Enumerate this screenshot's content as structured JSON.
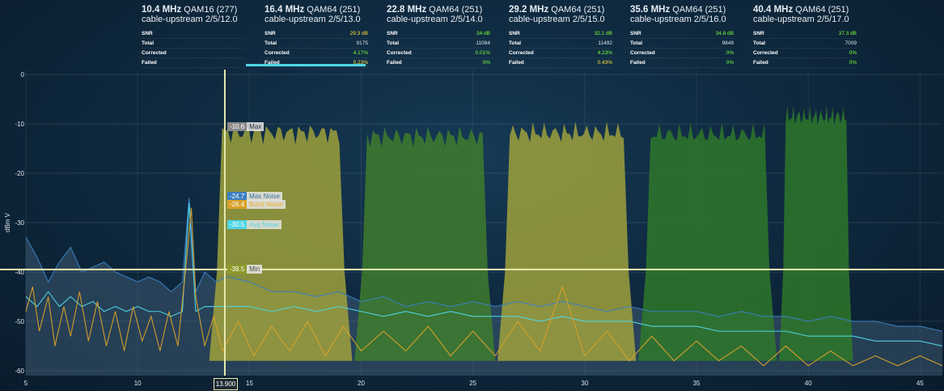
{
  "channels": [
    {
      "freq": "10.4 MHz",
      "mod": "QAM16 (277)",
      "name": "cable-upstream 2/5/12.0",
      "rows": [
        {
          "label": "SNR",
          "value": "",
          "cls": ""
        },
        {
          "label": "Total",
          "value": "",
          "cls": ""
        },
        {
          "label": "Corrected",
          "value": "",
          "cls": ""
        },
        {
          "label": "Failed",
          "value": "",
          "cls": ""
        }
      ],
      "selected": false
    },
    {
      "freq": "16.4 MHz",
      "mod": "QAM64 (251)",
      "name": "cable-upstream 2/5/13.0",
      "rows": [
        {
          "label": "SNR",
          "value": "29.3 dB",
          "cls": "warn"
        },
        {
          "label": "Total",
          "value": "9175",
          "cls": ""
        },
        {
          "label": "Corrected",
          "value": "4.17%",
          "cls": "ok"
        },
        {
          "label": "Failed",
          "value": "0.23%",
          "cls": "warn"
        }
      ],
      "selected": true
    },
    {
      "freq": "22.8 MHz",
      "mod": "QAM64 (251)",
      "name": "cable-upstream 2/5/14.0",
      "rows": [
        {
          "label": "SNR",
          "value": "34 dB",
          "cls": "ok"
        },
        {
          "label": "Total",
          "value": "11084",
          "cls": ""
        },
        {
          "label": "Corrected",
          "value": "0.01%",
          "cls": "ok"
        },
        {
          "label": "Failed",
          "value": "0%",
          "cls": "ok"
        }
      ],
      "selected": false
    },
    {
      "freq": "29.2 MHz",
      "mod": "QAM64 (251)",
      "name": "cable-upstream 2/5/15.0",
      "rows": [
        {
          "label": "SNR",
          "value": "32.1 dB",
          "cls": "ok"
        },
        {
          "label": "Total",
          "value": "11492",
          "cls": ""
        },
        {
          "label": "Corrected",
          "value": "4.23%",
          "cls": "ok"
        },
        {
          "label": "Failed",
          "value": "0.43%",
          "cls": "warn"
        }
      ],
      "selected": false
    },
    {
      "freq": "35.6 MHz",
      "mod": "QAM64 (251)",
      "name": "cable-upstream 2/5/16.0",
      "rows": [
        {
          "label": "SNR",
          "value": "34.8 dB",
          "cls": "ok"
        },
        {
          "label": "Total",
          "value": "9849",
          "cls": ""
        },
        {
          "label": "Corrected",
          "value": "0%",
          "cls": "ok"
        },
        {
          "label": "Failed",
          "value": "0%",
          "cls": "ok"
        }
      ],
      "selected": false
    },
    {
      "freq": "40.4 MHz",
      "mod": "QAM64 (251)",
      "name": "cable-upstream 2/5/17.0",
      "rows": [
        {
          "label": "SNR",
          "value": "37.3 dB",
          "cls": "ok"
        },
        {
          "label": "Total",
          "value": "7009",
          "cls": ""
        },
        {
          "label": "Corrected",
          "value": "0%",
          "cls": "ok"
        },
        {
          "label": "Failed",
          "value": "0%",
          "cls": "ok"
        }
      ],
      "selected": false
    }
  ],
  "chart_data": {
    "type": "area",
    "xlim": [
      5,
      46
    ],
    "ylim": [
      -61,
      1
    ],
    "x_ticks": [
      5,
      10,
      15,
      20,
      25,
      30,
      35,
      40,
      45
    ],
    "y_ticks": [
      0,
      -10,
      -20,
      -30,
      -40,
      -50,
      -60
    ],
    "ylabel": "dBm V",
    "cursor_x": 13.9,
    "cursor_label": "13.900",
    "cursor_markers": [
      {
        "value": "-10.6",
        "name": "Max",
        "y": -10.6,
        "color": "#8a8a8a",
        "text_color": "#ffffff"
      },
      {
        "value": "-24.7",
        "name": "Max Noise",
        "y": -24.7,
        "color": "#3a7fc0",
        "text_color": "#b9d4ee"
      },
      {
        "value": "-26.4",
        "name": "Burst Noise",
        "y": -26.4,
        "color": "#d9a12a",
        "text_color": "#f0b030"
      },
      {
        "value": "-30.5",
        "name": "Avg Noise",
        "y": -30.5,
        "color": "#4fd7e6",
        "text_color": "#4fd7e6"
      },
      {
        "value": "-39.5",
        "name": "Min",
        "y": -39.5,
        "color": "#8d9a2a",
        "text_color": "#e8e8b0"
      }
    ],
    "min_line_y": -39.5,
    "channel_blocks": [
      {
        "x0": 13.2,
        "x1": 19.6,
        "top": -10.3,
        "color": "#a3a53a"
      },
      {
        "x0": 19.7,
        "x1": 26.0,
        "top": -11.0,
        "color": "#3f7f2c"
      },
      {
        "x0": 26.1,
        "x1": 32.3,
        "top": -10.3,
        "color": "#a3a53a"
      },
      {
        "x0": 32.4,
        "x1": 38.6,
        "top": -10.6,
        "color": "#2f7a2a"
      },
      {
        "x0": 38.7,
        "x1": 42.0,
        "top": -7.0,
        "color": "#2f7a2a"
      }
    ],
    "series": [
      {
        "name": "Max Noise",
        "color": "#3a7fc0",
        "points": [
          [
            5,
            -33
          ],
          [
            5.5,
            -37
          ],
          [
            6,
            -42
          ],
          [
            6.5,
            -38
          ],
          [
            7,
            -35
          ],
          [
            7.5,
            -40
          ],
          [
            8,
            -39
          ],
          [
            8.5,
            -38
          ],
          [
            9,
            -40
          ],
          [
            9.5,
            -41
          ],
          [
            10,
            -42
          ],
          [
            10.5,
            -41
          ],
          [
            11,
            -42
          ],
          [
            11.5,
            -44
          ],
          [
            12,
            -42
          ],
          [
            12.3,
            -25
          ],
          [
            12.6,
            -44
          ],
          [
            13,
            -40
          ],
          [
            13.5,
            -42
          ],
          [
            14,
            -41
          ],
          [
            15,
            -42
          ],
          [
            16,
            -44
          ],
          [
            17,
            -44
          ],
          [
            18,
            -45
          ],
          [
            19,
            -44
          ],
          [
            20,
            -46
          ],
          [
            21,
            -45
          ],
          [
            22,
            -47
          ],
          [
            23,
            -46
          ],
          [
            24,
            -47
          ],
          [
            25,
            -46
          ],
          [
            26,
            -47
          ],
          [
            27,
            -46
          ],
          [
            28,
            -47
          ],
          [
            29,
            -46
          ],
          [
            30,
            -47
          ],
          [
            31,
            -48
          ],
          [
            32,
            -47
          ],
          [
            33,
            -48
          ],
          [
            34,
            -48
          ],
          [
            35,
            -48
          ],
          [
            36,
            -49
          ],
          [
            37,
            -48
          ],
          [
            38,
            -49
          ],
          [
            39,
            -49
          ],
          [
            40,
            -50
          ],
          [
            41,
            -49
          ],
          [
            42,
            -50
          ],
          [
            43,
            -50
          ],
          [
            44,
            -51
          ],
          [
            45,
            -51
          ],
          [
            46,
            -52
          ]
        ]
      },
      {
        "name": "Avg Noise",
        "color": "#4fd7e6",
        "points": [
          [
            5,
            -45
          ],
          [
            5.5,
            -47
          ],
          [
            6,
            -44
          ],
          [
            6.5,
            -47
          ],
          [
            7,
            -45
          ],
          [
            7.5,
            -47
          ],
          [
            8,
            -46
          ],
          [
            8.5,
            -48
          ],
          [
            9,
            -47
          ],
          [
            9.5,
            -48
          ],
          [
            10,
            -47
          ],
          [
            10.5,
            -48
          ],
          [
            11,
            -48
          ],
          [
            11.5,
            -49
          ],
          [
            12,
            -48
          ],
          [
            12.3,
            -26
          ],
          [
            12.6,
            -48
          ],
          [
            13,
            -47
          ],
          [
            14,
            -47
          ],
          [
            15,
            -47
          ],
          [
            16,
            -48
          ],
          [
            17,
            -47
          ],
          [
            18,
            -48
          ],
          [
            19,
            -47
          ],
          [
            20,
            -48
          ],
          [
            21,
            -49
          ],
          [
            22,
            -48
          ],
          [
            23,
            -49
          ],
          [
            24,
            -48
          ],
          [
            25,
            -49
          ],
          [
            26,
            -49
          ],
          [
            27,
            -49
          ],
          [
            28,
            -50
          ],
          [
            29,
            -49
          ],
          [
            30,
            -50
          ],
          [
            31,
            -50
          ],
          [
            32,
            -50
          ],
          [
            33,
            -51
          ],
          [
            34,
            -51
          ],
          [
            35,
            -51
          ],
          [
            36,
            -52
          ],
          [
            37,
            -52
          ],
          [
            38,
            -52
          ],
          [
            39,
            -52
          ],
          [
            40,
            -53
          ],
          [
            41,
            -53
          ],
          [
            42,
            -53
          ],
          [
            43,
            -54
          ],
          [
            44,
            -54
          ],
          [
            45,
            -54
          ],
          [
            46,
            -55
          ]
        ]
      },
      {
        "name": "Burst Noise",
        "color": "#d9a12a",
        "points": [
          [
            5,
            -48
          ],
          [
            5.3,
            -43
          ],
          [
            5.6,
            -52
          ],
          [
            6,
            -45
          ],
          [
            6.3,
            -55
          ],
          [
            6.7,
            -47
          ],
          [
            7,
            -53
          ],
          [
            7.4,
            -44
          ],
          [
            7.8,
            -54
          ],
          [
            8.2,
            -46
          ],
          [
            8.6,
            -55
          ],
          [
            9,
            -48
          ],
          [
            9.4,
            -56
          ],
          [
            9.8,
            -47
          ],
          [
            10.2,
            -54
          ],
          [
            10.6,
            -49
          ],
          [
            11,
            -56
          ],
          [
            11.4,
            -48
          ],
          [
            11.8,
            -55
          ],
          [
            12.2,
            -37
          ],
          [
            12.4,
            -27
          ],
          [
            12.6,
            -45
          ],
          [
            13,
            -55
          ],
          [
            13.4,
            -49
          ],
          [
            13.8,
            -56
          ],
          [
            14.5,
            -50
          ],
          [
            15.2,
            -57
          ],
          [
            16,
            -51
          ],
          [
            16.8,
            -56
          ],
          [
            17.6,
            -50
          ],
          [
            18.4,
            -57
          ],
          [
            19.2,
            -51
          ],
          [
            20,
            -56
          ],
          [
            21,
            -52
          ],
          [
            22,
            -56
          ],
          [
            23,
            -51
          ],
          [
            24,
            -57
          ],
          [
            25,
            -52
          ],
          [
            26,
            -57
          ],
          [
            27,
            -50
          ],
          [
            28,
            -56
          ],
          [
            29,
            -43
          ],
          [
            30,
            -57
          ],
          [
            31,
            -52
          ],
          [
            32,
            -58
          ],
          [
            33,
            -53
          ],
          [
            34,
            -58
          ],
          [
            35,
            -54
          ],
          [
            36,
            -58
          ],
          [
            37,
            -55
          ],
          [
            38,
            -59
          ],
          [
            39,
            -55
          ],
          [
            40,
            -59
          ],
          [
            41,
            -56
          ],
          [
            42,
            -59
          ],
          [
            43,
            -57
          ],
          [
            44,
            -59
          ],
          [
            45,
            -57
          ],
          [
            46,
            -59
          ]
        ]
      }
    ]
  }
}
